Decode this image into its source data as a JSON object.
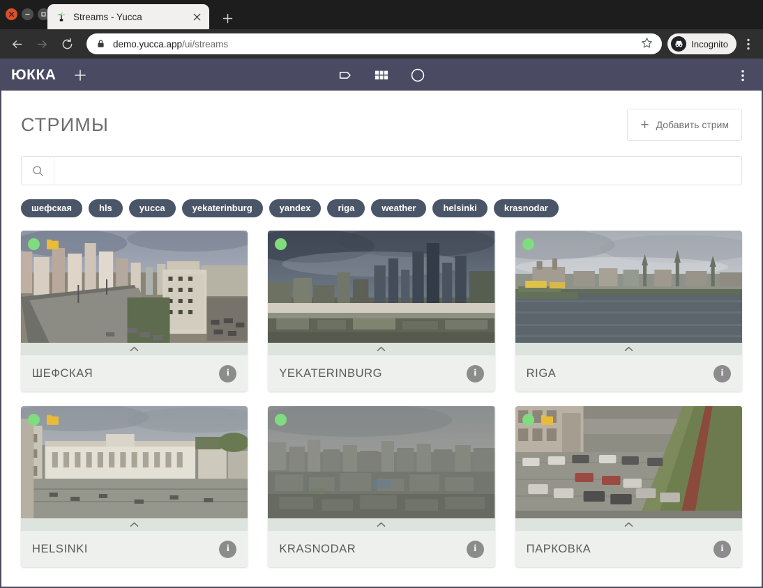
{
  "browser": {
    "tab": {
      "title": "Streams - Yucca",
      "favicon_icon": "palm-tree-icon",
      "close_icon": "close-icon"
    },
    "new_tab_icon": "plus-icon",
    "back_icon": "back-arrow-icon",
    "forward_icon": "forward-arrow-icon",
    "reload_icon": "reload-icon",
    "lock_icon": "lock-icon",
    "url_host": "demo.yucca.app",
    "url_path": "/ui/streams",
    "url_full": "demo.yucca.app/ui/streams",
    "star_icon": "star-icon",
    "incognito_label": "Incognito",
    "incognito_icon": "incognito-icon",
    "menu_icon": "kebab-menu-icon",
    "window_controls": [
      "close-button",
      "minimize-button",
      "maximize-button"
    ]
  },
  "app_header": {
    "logo": "ЮККА",
    "add_icon": "plus-icon",
    "nav_icons": [
      "tag-icon",
      "grid-icon",
      "circle-icon"
    ],
    "menu_icon": "kebab-menu-icon",
    "background_color": "#4a4a63"
  },
  "page": {
    "title": "СТРИМЫ",
    "add_stream_button": {
      "label": "Добавить стрим",
      "icon": "plus-icon"
    },
    "search": {
      "value": "",
      "placeholder": "",
      "icon": "search-icon"
    },
    "tags": [
      "шефская",
      "hls",
      "yucca",
      "yekaterinburg",
      "yandex",
      "riga",
      "weather",
      "helsinki",
      "krasnodar"
    ],
    "tag_color": "#4a5568"
  },
  "streams": [
    {
      "name": "ШЕФСКАЯ",
      "status": "live",
      "status_color": "#7fdc7f",
      "has_folder": true,
      "folder_color": "#e8bb3b",
      "collapse_icon": "chevron-up-icon",
      "info_icon": "info-icon",
      "thumb": {
        "sky": "#9aa0ac",
        "mid": "#b3aca4",
        "ground": "#7c7f74",
        "kind": "city-street"
      }
    },
    {
      "name": "YEKATERINBURG",
      "status": "live",
      "status_color": "#7fdc7f",
      "has_folder": false,
      "folder_color": "#e8bb3b",
      "collapse_icon": "chevron-up-icon",
      "info_icon": "info-icon",
      "thumb": {
        "sky": "#5e6570",
        "mid": "#4d5663",
        "ground": "#6e6f63",
        "kind": "storm-skyline"
      }
    },
    {
      "name": "RIGA",
      "status": "live",
      "status_color": "#7fdc7f",
      "has_folder": false,
      "folder_color": "#e8bb3b",
      "collapse_icon": "chevron-up-icon",
      "info_icon": "info-icon",
      "thumb": {
        "sky": "#b9bcc2",
        "mid": "#8e9298",
        "ground": "#5a6168",
        "kind": "river-town"
      }
    },
    {
      "name": "HELSINKI",
      "status": "live",
      "status_color": "#7fdc7f",
      "has_folder": true,
      "folder_color": "#e8bb3b",
      "collapse_icon": "chevron-up-icon",
      "info_icon": "info-icon",
      "thumb": {
        "sky": "#aeb3ba",
        "mid": "#cfd0cb",
        "ground": "#8d8f86",
        "kind": "harbor-square"
      }
    },
    {
      "name": "KRASNODAR",
      "status": "live",
      "status_color": "#7fdc7f",
      "has_folder": false,
      "folder_color": "#e8bb3b",
      "collapse_icon": "chevron-up-icon",
      "info_icon": "info-icon",
      "thumb": {
        "sky": "#8f9296",
        "mid": "#7b7d7c",
        "ground": "#6a6c66",
        "kind": "hazy-rooftops"
      }
    },
    {
      "name": "ПАРКОВКА",
      "status": "live",
      "status_color": "#7fdc7f",
      "has_folder": true,
      "folder_color": "#e8bb3b",
      "collapse_icon": "chevron-up-icon",
      "info_icon": "info-icon",
      "thumb": {
        "sky": "#9a9a92",
        "mid": "#8e8c83",
        "ground": "#6f7a58",
        "kind": "parking-lot"
      }
    }
  ]
}
